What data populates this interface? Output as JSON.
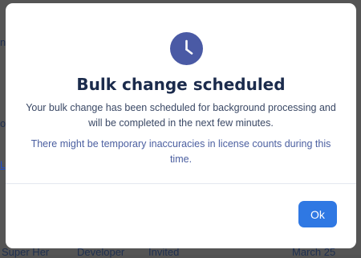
{
  "background": {
    "fragment_1": "n",
    "fragment_2": "ot",
    "fragment_3": "L",
    "row": {
      "name": "Super Her",
      "role": "Developer",
      "status": "Invited",
      "date": "March 25"
    }
  },
  "modal": {
    "icon": "clock-icon",
    "title": "Bulk change scheduled",
    "body": "Your bulk change has been scheduled for background processing and will be completed in the next few minutes.",
    "note": "There might be temporary inaccuracies in license counts during this time.",
    "ok_label": "Ok"
  },
  "colors": {
    "accent": "#2f78e3",
    "icon_bg": "#4a5aa5",
    "title": "#1b2b4c",
    "note": "#4b5fa0"
  }
}
